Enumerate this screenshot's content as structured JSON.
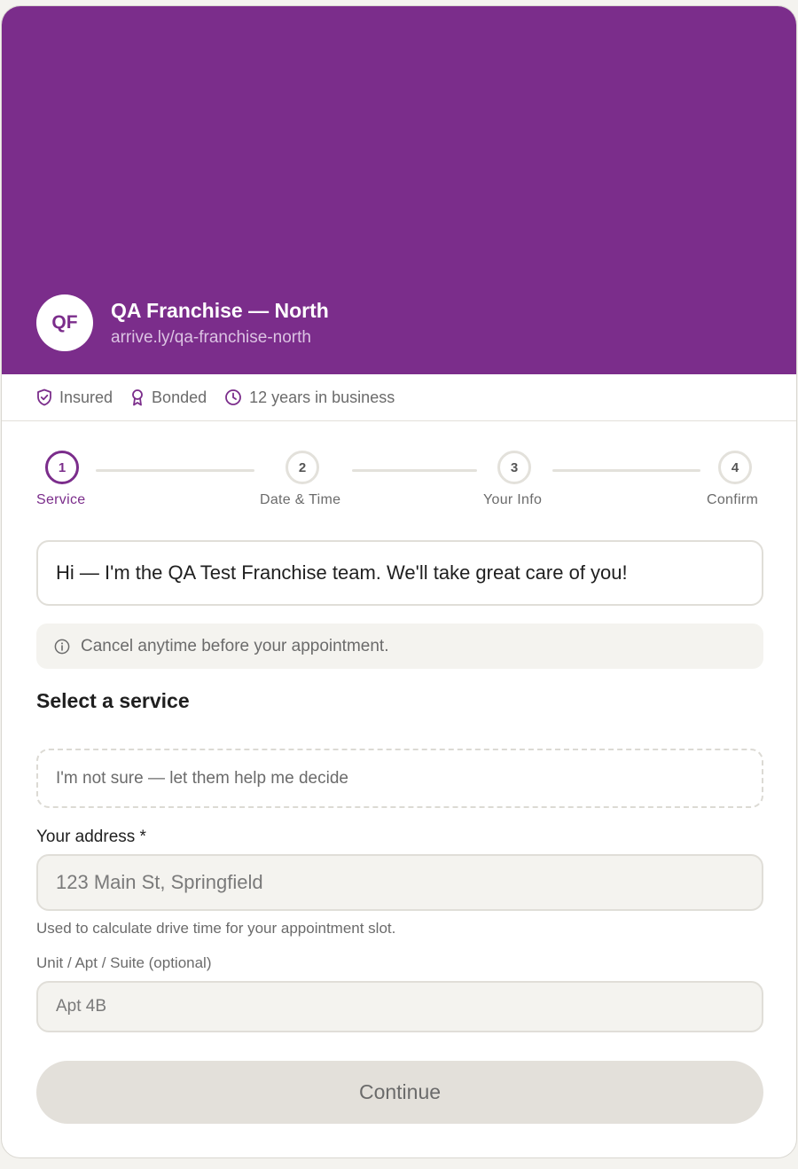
{
  "business": {
    "initials": "QF",
    "name": "QA Franchise — North",
    "url": "arrive.ly/qa-franchise-north",
    "brand_color": "#7b2d8b"
  },
  "trust_badges": [
    {
      "icon": "shield-check-icon",
      "label": "Insured"
    },
    {
      "icon": "ribbon-award-icon",
      "label": "Bonded"
    },
    {
      "icon": "clock-icon",
      "label": "12 years in business"
    }
  ],
  "stepper": {
    "current_step": 1,
    "steps": [
      {
        "number": "1",
        "label": "Service"
      },
      {
        "number": "2",
        "label": "Date & Time"
      },
      {
        "number": "3",
        "label": "Your Info"
      },
      {
        "number": "4",
        "label": "Confirm"
      }
    ]
  },
  "greeting": "Hi — I'm the QA Test Franchise team. We'll take great care of you!",
  "notice": {
    "icon": "info-icon",
    "text": "Cancel anytime before your appointment."
  },
  "service_section": {
    "title": "Select a service",
    "not_sure_option": "I'm not sure — let them help me decide"
  },
  "address": {
    "label": "Your address *",
    "value": "",
    "placeholder": "123 Main St, Springfield",
    "helper": "Used to calculate drive time for your appointment slot."
  },
  "unit": {
    "label": "Unit / Apt / Suite (optional)",
    "value": "",
    "placeholder": "Apt 4B"
  },
  "continue_label": "Continue"
}
